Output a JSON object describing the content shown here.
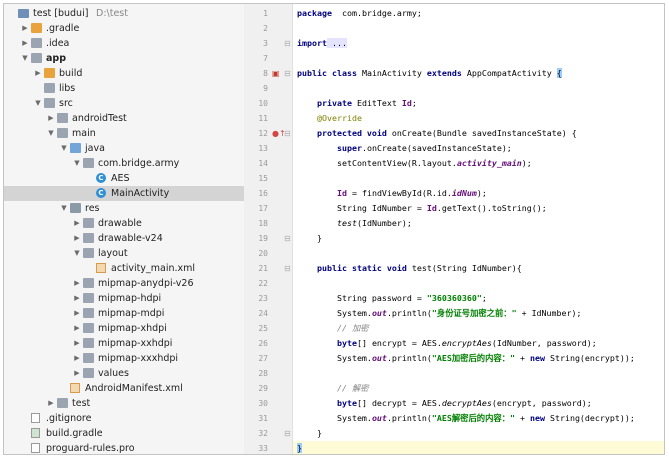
{
  "project_tree": [
    {
      "label": "test [budui]",
      "suffix": "D:\\test",
      "indent": 0,
      "arrow": "",
      "icon": "project",
      "bold": false,
      "selected": false
    },
    {
      "label": ".gradle",
      "indent": 1,
      "arrow": "right",
      "icon": "folder-orange",
      "bold": false,
      "selected": false
    },
    {
      "label": ".idea",
      "indent": 1,
      "arrow": "right",
      "icon": "folder",
      "bold": false,
      "selected": false
    },
    {
      "label": "app",
      "indent": 1,
      "arrow": "down",
      "icon": "folder",
      "bold": true,
      "selected": false
    },
    {
      "label": "build",
      "indent": 2,
      "arrow": "right",
      "icon": "folder-orange",
      "bold": false,
      "selected": false
    },
    {
      "label": "libs",
      "indent": 2,
      "arrow": "",
      "icon": "folder",
      "bold": false,
      "selected": false
    },
    {
      "label": "src",
      "indent": 2,
      "arrow": "down",
      "icon": "folder",
      "bold": false,
      "selected": false
    },
    {
      "label": "androidTest",
      "indent": 3,
      "arrow": "right",
      "icon": "folder",
      "bold": false,
      "selected": false
    },
    {
      "label": "main",
      "indent": 3,
      "arrow": "down",
      "icon": "folder",
      "bold": false,
      "selected": false
    },
    {
      "label": "java",
      "indent": 4,
      "arrow": "down",
      "icon": "folder-blue",
      "bold": false,
      "selected": false
    },
    {
      "label": "com.bridge.army",
      "indent": 5,
      "arrow": "down",
      "icon": "folder",
      "bold": false,
      "selected": false
    },
    {
      "label": "AES",
      "indent": 6,
      "arrow": "",
      "icon": "class",
      "bold": false,
      "selected": false
    },
    {
      "label": "MainActivity",
      "indent": 6,
      "arrow": "",
      "icon": "class",
      "bold": false,
      "selected": true
    },
    {
      "label": "res",
      "indent": 4,
      "arrow": "down",
      "icon": "folder-res",
      "bold": false,
      "selected": false
    },
    {
      "label": "drawable",
      "indent": 5,
      "arrow": "right",
      "icon": "folder",
      "bold": false,
      "selected": false
    },
    {
      "label": "drawable-v24",
      "indent": 5,
      "arrow": "right",
      "icon": "folder",
      "bold": false,
      "selected": false
    },
    {
      "label": "layout",
      "indent": 5,
      "arrow": "down",
      "icon": "folder",
      "bold": false,
      "selected": false
    },
    {
      "label": "activity_main.xml",
      "indent": 6,
      "arrow": "",
      "icon": "xml",
      "bold": false,
      "selected": false
    },
    {
      "label": "mipmap-anydpi-v26",
      "indent": 5,
      "arrow": "right",
      "icon": "folder",
      "bold": false,
      "selected": false
    },
    {
      "label": "mipmap-hdpi",
      "indent": 5,
      "arrow": "right",
      "icon": "folder",
      "bold": false,
      "selected": false
    },
    {
      "label": "mipmap-mdpi",
      "indent": 5,
      "arrow": "right",
      "icon": "folder",
      "bold": false,
      "selected": false
    },
    {
      "label": "mipmap-xhdpi",
      "indent": 5,
      "arrow": "right",
      "icon": "folder",
      "bold": false,
      "selected": false
    },
    {
      "label": "mipmap-xxhdpi",
      "indent": 5,
      "arrow": "right",
      "icon": "folder",
      "bold": false,
      "selected": false
    },
    {
      "label": "mipmap-xxxhdpi",
      "indent": 5,
      "arrow": "right",
      "icon": "folder",
      "bold": false,
      "selected": false
    },
    {
      "label": "values",
      "indent": 5,
      "arrow": "right",
      "icon": "folder",
      "bold": false,
      "selected": false
    },
    {
      "label": "AndroidManifest.xml",
      "indent": 4,
      "arrow": "",
      "icon": "xml",
      "bold": false,
      "selected": false
    },
    {
      "label": "test",
      "indent": 3,
      "arrow": "right",
      "icon": "folder",
      "bold": false,
      "selected": false
    },
    {
      "label": ".gitignore",
      "indent": 1,
      "arrow": "",
      "icon": "file",
      "bold": false,
      "selected": false
    },
    {
      "label": "build.gradle",
      "indent": 1,
      "arrow": "",
      "icon": "gradle",
      "bold": false,
      "selected": false
    },
    {
      "label": "proguard-rules.pro",
      "indent": 1,
      "arrow": "",
      "icon": "file",
      "bold": false,
      "selected": false
    }
  ],
  "editor": {
    "lines": [
      {
        "n": "1",
        "parts": [
          [
            "kw",
            "package"
          ],
          [
            "",
            "  com.bridge.army;"
          ]
        ]
      },
      {
        "n": "2",
        "parts": []
      },
      {
        "n": "3",
        "parts": [
          [
            "kw",
            "import"
          ],
          [
            "",
            ""
          ],
          [
            "fold",
            " ..."
          ]
        ]
      },
      {
        "n": "7",
        "parts": []
      },
      {
        "n": "8",
        "parts": [
          [
            "kw",
            "public class"
          ],
          [
            "",
            " MainActivity "
          ],
          [
            "kw",
            "extends"
          ],
          [
            "",
            " AppCompatActivity "
          ],
          [
            "brace-hl",
            "{"
          ]
        ]
      },
      {
        "n": "9",
        "parts": []
      },
      {
        "n": "10",
        "parts": [
          [
            "",
            "    "
          ],
          [
            "kw",
            "private"
          ],
          [
            "",
            " EditText "
          ],
          [
            "field",
            "Id"
          ],
          [
            "",
            ";"
          ]
        ]
      },
      {
        "n": "11",
        "parts": [
          [
            "",
            "    "
          ],
          [
            "ann",
            "@Override"
          ]
        ]
      },
      {
        "n": "12",
        "parts": [
          [
            "",
            "    "
          ],
          [
            "kw",
            "protected void"
          ],
          [
            "",
            " onCreate(Bundle savedInstanceState) {"
          ]
        ]
      },
      {
        "n": "13",
        "parts": [
          [
            "",
            "        "
          ],
          [
            "kw",
            "super"
          ],
          [
            "",
            ".onCreate(savedInstanceState);"
          ]
        ]
      },
      {
        "n": "14",
        "parts": [
          [
            "",
            "        setContentView(R.layout."
          ],
          [
            "field ital",
            "activity_main"
          ],
          [
            "",
            ");"
          ]
        ]
      },
      {
        "n": "15",
        "parts": []
      },
      {
        "n": "16",
        "parts": [
          [
            "",
            "        "
          ],
          [
            "field",
            "Id"
          ],
          [
            "",
            " = findViewById(R.id."
          ],
          [
            "field ital",
            "idNum"
          ],
          [
            "",
            ");"
          ]
        ]
      },
      {
        "n": "17",
        "parts": [
          [
            "",
            "        String IdNumber = "
          ],
          [
            "field",
            "Id"
          ],
          [
            "",
            ".getText().toString();"
          ]
        ]
      },
      {
        "n": "18",
        "parts": [
          [
            "",
            "        "
          ],
          [
            "ital",
            "test"
          ],
          [
            "",
            "(IdNumber);"
          ]
        ]
      },
      {
        "n": "19",
        "parts": [
          [
            "",
            "    }"
          ]
        ]
      },
      {
        "n": "20",
        "parts": []
      },
      {
        "n": "21",
        "parts": [
          [
            "",
            "    "
          ],
          [
            "kw",
            "public static void"
          ],
          [
            "",
            " test(String IdNumber){"
          ]
        ]
      },
      {
        "n": "22",
        "parts": []
      },
      {
        "n": "23",
        "parts": [
          [
            "",
            "        String password = "
          ],
          [
            "str",
            "\"360360360\""
          ],
          [
            "",
            ";"
          ]
        ]
      },
      {
        "n": "24",
        "parts": [
          [
            "",
            "        System."
          ],
          [
            "field ital",
            "out"
          ],
          [
            "",
            ".println("
          ],
          [
            "str",
            "\"身份证号加密之前：\""
          ],
          [
            "",
            " + IdNumber);"
          ]
        ]
      },
      {
        "n": "25",
        "parts": [
          [
            "",
            "        "
          ],
          [
            "cmt",
            "// 加密"
          ]
        ]
      },
      {
        "n": "26",
        "parts": [
          [
            "",
            "        "
          ],
          [
            "kw",
            "byte"
          ],
          [
            "",
            "[] encrypt = AES."
          ],
          [
            "ital",
            "encryptAes"
          ],
          [
            "",
            "(IdNumber, password);"
          ]
        ]
      },
      {
        "n": "27",
        "parts": [
          [
            "",
            "        System."
          ],
          [
            "field ital",
            "out"
          ],
          [
            "",
            ".println("
          ],
          [
            "str",
            "\"AES加密后的内容：\""
          ],
          [
            "",
            " + "
          ],
          [
            "kw",
            "new"
          ],
          [
            "",
            " String(encrypt));"
          ]
        ]
      },
      {
        "n": "28",
        "parts": []
      },
      {
        "n": "29",
        "parts": [
          [
            "",
            "        "
          ],
          [
            "cmt",
            "// 解密"
          ]
        ]
      },
      {
        "n": "30",
        "parts": [
          [
            "",
            "        "
          ],
          [
            "kw",
            "byte"
          ],
          [
            "",
            "[] decrypt = AES."
          ],
          [
            "ital",
            "decryptAes"
          ],
          [
            "",
            "(encrypt, password);"
          ]
        ]
      },
      {
        "n": "31",
        "parts": [
          [
            "",
            "        System."
          ],
          [
            "field ital",
            "out"
          ],
          [
            "",
            ".println("
          ],
          [
            "str",
            "\"AES解密后的内容：\""
          ],
          [
            "",
            " + "
          ],
          [
            "kw",
            "new"
          ],
          [
            "",
            " String(decrypt));"
          ]
        ]
      },
      {
        "n": "32",
        "parts": [
          [
            "",
            "    }"
          ]
        ]
      },
      {
        "n": "33",
        "parts": [
          [
            "brace-hl2",
            "}"
          ]
        ]
      }
    ],
    "active_line": "33",
    "gutter_marks": [
      {
        "line": "8",
        "mark": "activity-icon",
        "color": "#c0392b"
      },
      {
        "line": "12",
        "mark": "override-icon",
        "color": "#d64545"
      }
    ]
  }
}
